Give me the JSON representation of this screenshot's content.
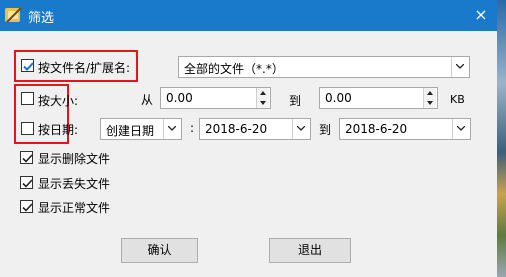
{
  "window": {
    "title": "筛选",
    "close_glyph": "×"
  },
  "filters": {
    "by_name": {
      "label": "按文件名/扩展名:",
      "checked": true,
      "value": "全部的文件（*.*）"
    },
    "by_size": {
      "label": "按大小:",
      "checked": false,
      "from_label": "从",
      "from_value": "0.00",
      "to_label": "到",
      "to_value": "0.00",
      "unit": "KB"
    },
    "by_date": {
      "label": "按日期:",
      "checked": false,
      "date_type": "创建日期",
      "from_value": "2018-6-20",
      "to_label": "到",
      "to_value": "2018-6-20"
    }
  },
  "options": [
    {
      "label": "显示删除文件",
      "checked": true
    },
    {
      "label": "显示丢失文件",
      "checked": true
    },
    {
      "label": "显示正常文件",
      "checked": true
    }
  ],
  "buttons": {
    "ok": "确认",
    "exit": "退出"
  },
  "colors": {
    "titlebar": "#1979ca",
    "highlight_border": "#e8141b",
    "checkbox_blue": "#1e73c9"
  }
}
